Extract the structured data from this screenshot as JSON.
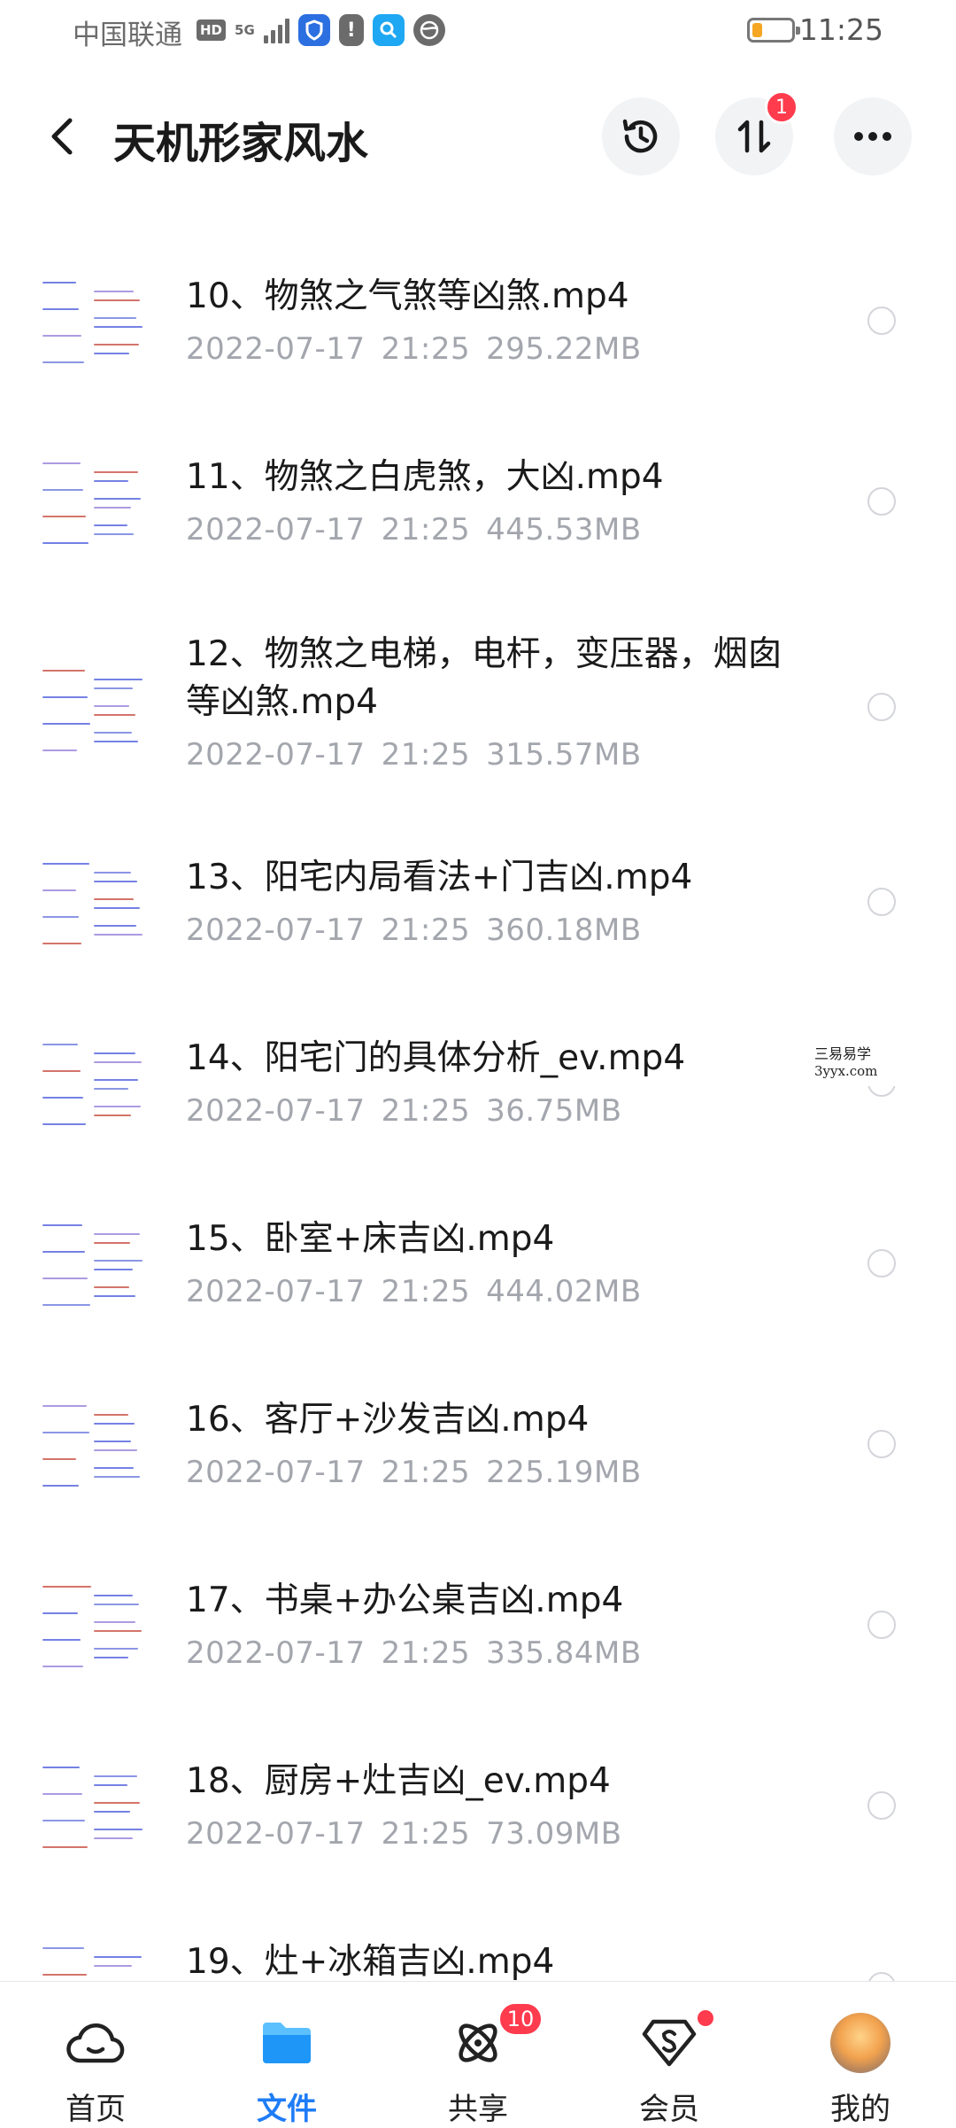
{
  "status_bar": {
    "carrier": "中国联通",
    "hd_badge": "HD",
    "network": "5G",
    "time": "11:25",
    "battery_level": 0.25,
    "icons": [
      "hd-icon",
      "signal-icon",
      "shield-app-icon",
      "alert-icon",
      "search-app-icon",
      "globe-app-icon",
      "battery-icon"
    ]
  },
  "header": {
    "title": "天机形家风水",
    "transfer_badge": "1"
  },
  "files": [
    {
      "name": "10、物煞之气煞等凶煞.mp4",
      "date": "2022-07-17",
      "time": "21:25",
      "size": "295.22MB"
    },
    {
      "name": "11、物煞之白虎煞，大凶.mp4",
      "date": "2022-07-17",
      "time": "21:25",
      "size": "445.53MB"
    },
    {
      "name": "12、物煞之电梯，电杆，变压器，烟囱等凶煞.mp4",
      "date": "2022-07-17",
      "time": "21:25",
      "size": "315.57MB"
    },
    {
      "name": "13、阳宅内局看法+门吉凶.mp4",
      "date": "2022-07-17",
      "time": "21:25",
      "size": "360.18MB"
    },
    {
      "name": "14、阳宅门的具体分析_ev.mp4",
      "date": "2022-07-17",
      "time": "21:25",
      "size": "36.75MB"
    },
    {
      "name": "15、卧室+床吉凶.mp4",
      "date": "2022-07-17",
      "time": "21:25",
      "size": "444.02MB"
    },
    {
      "name": "16、客厅+沙发吉凶.mp4",
      "date": "2022-07-17",
      "time": "21:25",
      "size": "225.19MB"
    },
    {
      "name": "17、书桌+办公桌吉凶.mp4",
      "date": "2022-07-17",
      "time": "21:25",
      "size": "335.84MB"
    },
    {
      "name": "18、厨房+灶吉凶_ev.mp4",
      "date": "2022-07-17",
      "time": "21:25",
      "size": "73.09MB"
    },
    {
      "name": "19、灶+冰箱吉凶.mp4",
      "date": "",
      "time": "",
      "size": ""
    }
  ],
  "watermark": {
    "line1": "三易易学",
    "line2": "3yyx.com"
  },
  "bottom_nav": {
    "tabs": [
      {
        "label": "首页",
        "icon": "cloud-home-icon"
      },
      {
        "label": "文件",
        "icon": "folder-icon"
      },
      {
        "label": "共享",
        "icon": "atom-share-icon",
        "badge": "10"
      },
      {
        "label": "会员",
        "icon": "diamond-member-icon"
      },
      {
        "label": "我的",
        "icon": "avatar"
      }
    ],
    "active": "文件"
  },
  "colors": {
    "accent": "#1e7cf7",
    "badge": "#ff3b4e",
    "meta_text": "#a3a6ad"
  }
}
